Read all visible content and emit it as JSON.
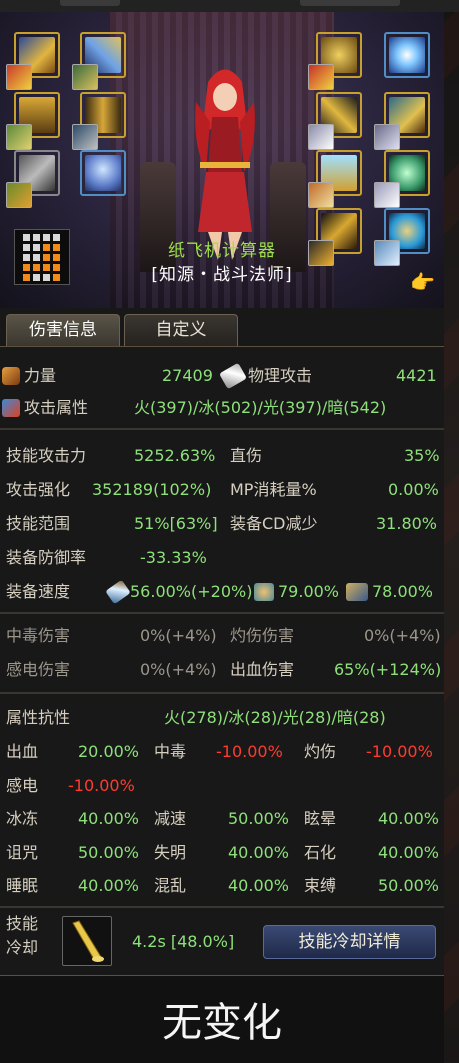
{
  "header": {
    "player_name": "纸飞机计算器",
    "class_title": "[知源・战斗法师]"
  },
  "equipment": {
    "left_slots": [
      "shoulder-armor-icon",
      "weapon-icon",
      "chest-armor-icon",
      "belt-icon",
      "gauntlet-icon",
      "pet-icon"
    ],
    "right_slots": [
      "ring-icon",
      "title-emblem-icon",
      "bracelet-icon",
      "necklace-icon",
      "earring-icon",
      "gem-icon",
      "magic-stone-icon",
      "auxiliary-icon"
    ]
  },
  "tabs": [
    {
      "label": "伤害信息",
      "active": true
    },
    {
      "label": "自定义",
      "active": false
    }
  ],
  "stats": {
    "strength": {
      "label": "力量",
      "value": "27409"
    },
    "physical_attack": {
      "label": "物理攻击",
      "value": "4421"
    },
    "attack_element": {
      "label": "攻击属性",
      "value": "火(397)/冰(502)/光(397)/暗(542)"
    },
    "skill_attack": {
      "label": "技能攻击力",
      "value": "5252.63%"
    },
    "direct_damage": {
      "label": "直伤",
      "value": "35%"
    },
    "attack_boost": {
      "label": "攻击强化",
      "value": "352189(102%)"
    },
    "mp_consume": {
      "label": "MP消耗量%",
      "value": "0.00%"
    },
    "skill_range": {
      "label": "技能范围",
      "value": "51%[63%]"
    },
    "cd_reduce": {
      "label": "装备CD减少",
      "value": "31.80%"
    },
    "defense_rate": {
      "label": "装备防御率",
      "value": "-33.33%"
    },
    "speed": {
      "label": "装备速度",
      "attack_speed": "56.00%(+20%)",
      "cast_speed": "79.00%",
      "move_speed": "78.00%"
    }
  },
  "damage_over_time": {
    "poison": {
      "label": "中毒伤害",
      "value": "0%(+4%)"
    },
    "burn": {
      "label": "灼伤伤害",
      "value": "0%(+4%)"
    },
    "shock": {
      "label": "感电伤害",
      "value": "0%(+4%)"
    },
    "bleed": {
      "label": "出血伤害",
      "value": "65%(+124%)"
    }
  },
  "resistance": {
    "label": "属性抗性",
    "value": "火(278)/冰(28)/光(28)/暗(28)",
    "items": [
      {
        "label": "出血",
        "value": "20.00%"
      },
      {
        "label": "中毒",
        "value": "-10.00%"
      },
      {
        "label": "灼伤",
        "value": "-10.00%"
      },
      {
        "label": "感电",
        "value": "-10.00%"
      },
      {
        "label": "冰冻",
        "value": "40.00%"
      },
      {
        "label": "减速",
        "value": "50.00%"
      },
      {
        "label": "眩晕",
        "value": "40.00%"
      },
      {
        "label": "诅咒",
        "value": "50.00%"
      },
      {
        "label": "失明",
        "value": "40.00%"
      },
      {
        "label": "石化",
        "value": "40.00%"
      },
      {
        "label": "睡眠",
        "value": "40.00%"
      },
      {
        "label": "混乱",
        "value": "40.00%"
      },
      {
        "label": "束缚",
        "value": "50.00%"
      }
    ]
  },
  "cooldown": {
    "label_line1": "技能",
    "label_line2": "冷却",
    "value": "4.2s [48.0%]",
    "button": "技能冷却详情"
  },
  "footer": {
    "text": "无变化"
  },
  "colors": {
    "accent_green": "#8ee07a",
    "negative_red": "#ff3b2e",
    "gold_frame": "#c7a02e"
  }
}
